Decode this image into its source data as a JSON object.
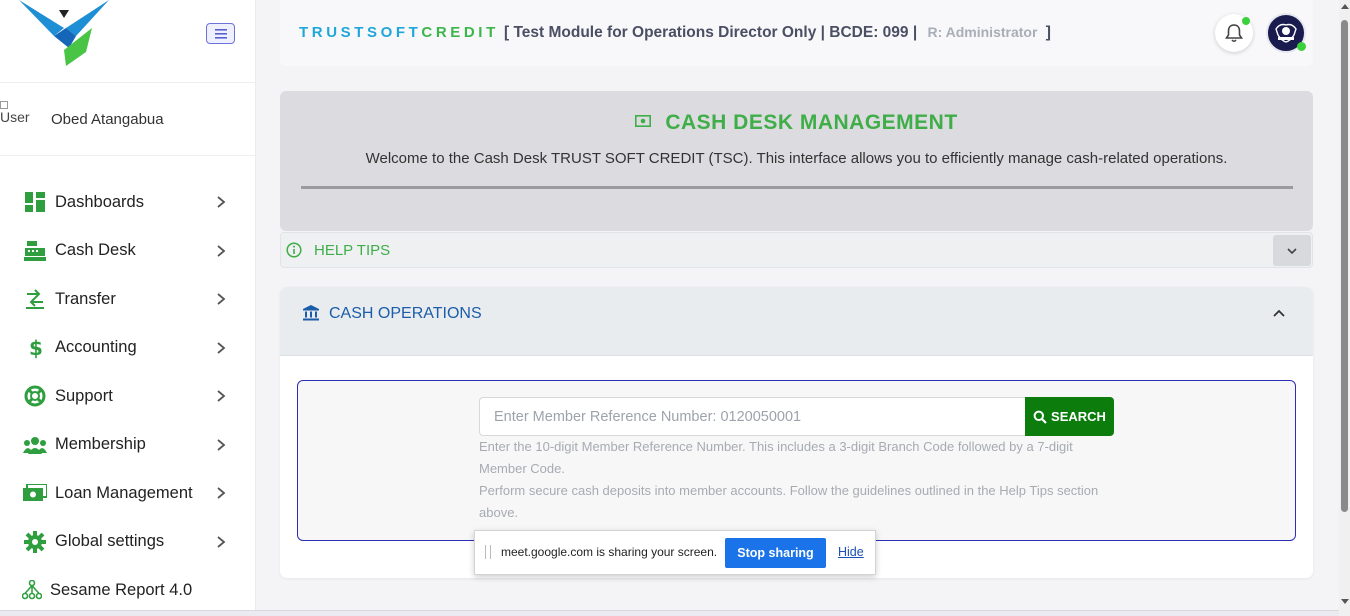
{
  "sidebar": {
    "user": {
      "avatar_alt": "User",
      "name": "Obed Atangabua"
    },
    "items": [
      {
        "label": "Dashboards",
        "icon": "dashboard-icon"
      },
      {
        "label": "Cash Desk",
        "icon": "cash-register-icon"
      },
      {
        "label": "Transfer",
        "icon": "transfer-icon"
      },
      {
        "label": "Accounting",
        "icon": "dollar-icon"
      },
      {
        "label": "Support",
        "icon": "lifebuoy-icon"
      },
      {
        "label": "Membership",
        "icon": "users-icon"
      },
      {
        "label": "Loan Management",
        "icon": "money-bill-icon"
      },
      {
        "label": "Global settings",
        "icon": "gear-icon"
      },
      {
        "label": "Sesame Report 4.0",
        "icon": "sitemap-icon"
      }
    ]
  },
  "header": {
    "brand_trust": "TRUSTSOFT",
    "brand_credit": "CREDIT",
    "module": "[ Test Module for Operations Director Only | BCDE: 099 |",
    "role": "R: Administrator",
    "close_bracket": "]"
  },
  "hero": {
    "title": "CASH DESK MANAGEMENT",
    "description": "Welcome to the Cash Desk TRUST SOFT CREDIT (TSC). This interface allows you to efficiently manage cash-related operations."
  },
  "help": {
    "label": "HELP TIPS"
  },
  "operations": {
    "title": "CASH OPERATIONS",
    "search": {
      "placeholder": "Enter Member Reference Number: 0120050001",
      "button_label": "SEARCH"
    },
    "hint_1": "Enter the 10-digit Member Reference Number. This includes a 3-digit Branch Code followed by a 7-digit Member Code.",
    "hint_2": "Perform secure cash deposits into member accounts. Follow the guidelines outlined in the Help Tips section above."
  },
  "share_bar": {
    "message": "meet.google.com is sharing your screen.",
    "stop_label": "Stop sharing",
    "hide_label": "Hide"
  },
  "colors": {
    "brand_blue": "#1ea7d8",
    "brand_green": "#3cb54a",
    "search_green": "#0c7d0c",
    "ops_blue": "#1a5da8",
    "panel_border": "#2b2fb5"
  }
}
